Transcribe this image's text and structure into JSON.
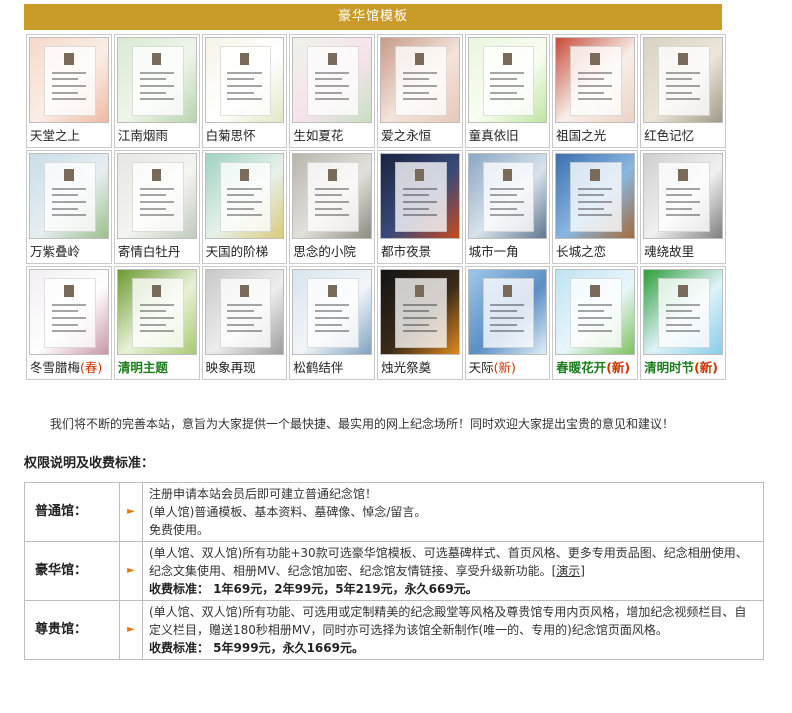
{
  "banner": {
    "title": "豪华馆模板"
  },
  "templates": [
    [
      {
        "label": "天堂之上",
        "tag": "",
        "green": false,
        "colors": [
          "#f6d9c9",
          "#f0b9a4",
          "#f9eee6"
        ]
      },
      {
        "label": "江南烟雨",
        "tag": "",
        "green": false,
        "colors": [
          "#dbe9d4",
          "#b9d3ad",
          "#eef5ea"
        ]
      },
      {
        "label": "白菊思怀",
        "tag": "",
        "green": false,
        "colors": [
          "#f6f4e8",
          "#e2e7c6",
          "#ffffff"
        ]
      },
      {
        "label": "生如夏花",
        "tag": "",
        "green": false,
        "colors": [
          "#eef3ea",
          "#c7e0c3",
          "#f7e2ec"
        ]
      },
      {
        "label": "爱之永恒",
        "tag": "",
        "green": false,
        "colors": [
          "#c79a88",
          "#e7c7b8",
          "#f3e4dc"
        ]
      },
      {
        "label": "童真依旧",
        "tag": "",
        "green": false,
        "colors": [
          "#eaf6de",
          "#bfe5a0",
          "#f8fdf2"
        ]
      },
      {
        "label": "祖国之光",
        "tag": "",
        "green": false,
        "colors": [
          "#c94b3b",
          "#ead2c6",
          "#f7efe9"
        ]
      },
      {
        "label": "红色记忆",
        "tag": "",
        "green": false,
        "colors": [
          "#d7d2c2",
          "#9f9a88",
          "#ebe6d8"
        ]
      }
    ],
    [
      {
        "label": "万紫叠岭",
        "tag": "",
        "green": false,
        "colors": [
          "#c9dde8",
          "#9bbf8a",
          "#e7eef2"
        ]
      },
      {
        "label": "寄情白牡丹",
        "tag": "",
        "green": false,
        "colors": [
          "#e4e7e2",
          "#c1c9bd",
          "#f3f5f1"
        ]
      },
      {
        "label": "天国的阶梯",
        "tag": "",
        "green": false,
        "colors": [
          "#9ed3c2",
          "#d8c97a",
          "#e7f1ea"
        ]
      },
      {
        "label": "思念的小院",
        "tag": "",
        "green": false,
        "colors": [
          "#b7b5ae",
          "#8d8a82",
          "#e2e0da"
        ]
      },
      {
        "label": "都市夜景",
        "tag": "",
        "green": false,
        "colors": [
          "#1b2340",
          "#c94a1f",
          "#3a4a7a"
        ]
      },
      {
        "label": "城市一角",
        "tag": "",
        "green": false,
        "colors": [
          "#8aa7c4",
          "#5f7891",
          "#d8e2ec"
        ]
      },
      {
        "label": "长城之恋",
        "tag": "",
        "green": false,
        "colors": [
          "#3d6fb0",
          "#a46b3b",
          "#88b7e0"
        ]
      },
      {
        "label": "魂绕故里",
        "tag": "",
        "green": false,
        "colors": [
          "#cfcfcf",
          "#7f7f7f",
          "#f0f0f0"
        ]
      }
    ],
    [
      {
        "label": "冬雪腊梅",
        "tag": "(春)",
        "green": false,
        "colors": [
          "#f2eef2",
          "#c996a8",
          "#ffffff"
        ]
      },
      {
        "label": "清明主题",
        "tag": "",
        "green": true,
        "colors": [
          "#6b9a2f",
          "#a9c971",
          "#e8f1d8"
        ]
      },
      {
        "label": "映象再现",
        "tag": "",
        "green": false,
        "colors": [
          "#c8c8c8",
          "#9c9c9c",
          "#ededed"
        ]
      },
      {
        "label": "松鹤结伴",
        "tag": "",
        "green": false,
        "colors": [
          "#d9e4ee",
          "#7fa2c1",
          "#f1f5f9"
        ]
      },
      {
        "label": "烛光祭奠",
        "tag": "",
        "green": false,
        "colors": [
          "#141414",
          "#e08a1f",
          "#3a2a1a"
        ]
      },
      {
        "label": "天际",
        "tag": "(新)",
        "green": false,
        "colors": [
          "#9fc7ea",
          "#e0eef9",
          "#5b8fc4"
        ]
      },
      {
        "label": "春暖花开",
        "tag": "(新)",
        "green": true,
        "colors": [
          "#bfe3f2",
          "#7cc35b",
          "#e9f6fb"
        ]
      },
      {
        "label": "清明时节",
        "tag": "(新)",
        "green": true,
        "colors": [
          "#2f9e3a",
          "#86cde9",
          "#dff2f9"
        ]
      }
    ]
  ],
  "notice": "我们将不断的完善本站，意旨为大家提供一个最快捷、最实用的网上纪念场所！同时欢迎大家提出宝贵的意见和建议！",
  "section_title": "权限说明及收费标准：",
  "fees": [
    {
      "name": "普通馆：",
      "lines": [
        "注册申请本站会员后即可建立普通纪念馆！",
        "(单人馆)普通模板、基本资料、墓碑像、悼念/留言。",
        "免费使用。"
      ],
      "demo": "",
      "price": ""
    },
    {
      "name": "豪华馆：",
      "lines": [
        "(单人馆、双人馆)所有功能+30款可选豪华馆模板、可选墓碑样式、首页风格、更多专用贡品图、纪念相册使用、纪念文集使用、相册MV、纪念馆加密、纪念馆友情链接、享受升级新功能。"
      ],
      "demo": "演示",
      "price": "收费标准： 1年69元，2年99元，5年219元，永久669元。"
    },
    {
      "name": "尊贵馆：",
      "lines": [
        "(单人馆、双人馆)所有功能、可选用或定制精美的纪念殿堂等风格及尊贵馆专用内页风格，增加纪念视频栏目、自定义栏目，赠送180秒相册MV，同时亦可选择为该馆全新制作(唯一的、专用的)纪念馆页面风格。"
      ],
      "demo": "",
      "price": "收费标准： 5年999元，永久1669元。"
    }
  ],
  "icons": {
    "arrow": "arrow-bullet-icon"
  }
}
